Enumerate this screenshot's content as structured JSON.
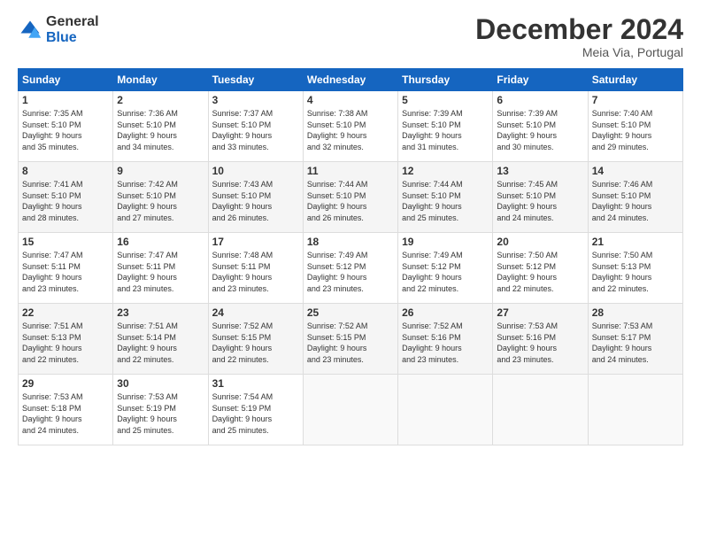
{
  "logo": {
    "general": "General",
    "blue": "Blue"
  },
  "header": {
    "month": "December 2024",
    "location": "Meia Via, Portugal"
  },
  "weekdays": [
    "Sunday",
    "Monday",
    "Tuesday",
    "Wednesday",
    "Thursday",
    "Friday",
    "Saturday"
  ],
  "weeks": [
    [
      {
        "day": "1",
        "info": "Sunrise: 7:35 AM\nSunset: 5:10 PM\nDaylight: 9 hours\nand 35 minutes."
      },
      {
        "day": "2",
        "info": "Sunrise: 7:36 AM\nSunset: 5:10 PM\nDaylight: 9 hours\nand 34 minutes."
      },
      {
        "day": "3",
        "info": "Sunrise: 7:37 AM\nSunset: 5:10 PM\nDaylight: 9 hours\nand 33 minutes."
      },
      {
        "day": "4",
        "info": "Sunrise: 7:38 AM\nSunset: 5:10 PM\nDaylight: 9 hours\nand 32 minutes."
      },
      {
        "day": "5",
        "info": "Sunrise: 7:39 AM\nSunset: 5:10 PM\nDaylight: 9 hours\nand 31 minutes."
      },
      {
        "day": "6",
        "info": "Sunrise: 7:39 AM\nSunset: 5:10 PM\nDaylight: 9 hours\nand 30 minutes."
      },
      {
        "day": "7",
        "info": "Sunrise: 7:40 AM\nSunset: 5:10 PM\nDaylight: 9 hours\nand 29 minutes."
      }
    ],
    [
      {
        "day": "8",
        "info": "Sunrise: 7:41 AM\nSunset: 5:10 PM\nDaylight: 9 hours\nand 28 minutes."
      },
      {
        "day": "9",
        "info": "Sunrise: 7:42 AM\nSunset: 5:10 PM\nDaylight: 9 hours\nand 27 minutes."
      },
      {
        "day": "10",
        "info": "Sunrise: 7:43 AM\nSunset: 5:10 PM\nDaylight: 9 hours\nand 26 minutes."
      },
      {
        "day": "11",
        "info": "Sunrise: 7:44 AM\nSunset: 5:10 PM\nDaylight: 9 hours\nand 26 minutes."
      },
      {
        "day": "12",
        "info": "Sunrise: 7:44 AM\nSunset: 5:10 PM\nDaylight: 9 hours\nand 25 minutes."
      },
      {
        "day": "13",
        "info": "Sunrise: 7:45 AM\nSunset: 5:10 PM\nDaylight: 9 hours\nand 24 minutes."
      },
      {
        "day": "14",
        "info": "Sunrise: 7:46 AM\nSunset: 5:10 PM\nDaylight: 9 hours\nand 24 minutes."
      }
    ],
    [
      {
        "day": "15",
        "info": "Sunrise: 7:47 AM\nSunset: 5:11 PM\nDaylight: 9 hours\nand 23 minutes."
      },
      {
        "day": "16",
        "info": "Sunrise: 7:47 AM\nSunset: 5:11 PM\nDaylight: 9 hours\nand 23 minutes."
      },
      {
        "day": "17",
        "info": "Sunrise: 7:48 AM\nSunset: 5:11 PM\nDaylight: 9 hours\nand 23 minutes."
      },
      {
        "day": "18",
        "info": "Sunrise: 7:49 AM\nSunset: 5:12 PM\nDaylight: 9 hours\nand 23 minutes."
      },
      {
        "day": "19",
        "info": "Sunrise: 7:49 AM\nSunset: 5:12 PM\nDaylight: 9 hours\nand 22 minutes."
      },
      {
        "day": "20",
        "info": "Sunrise: 7:50 AM\nSunset: 5:12 PM\nDaylight: 9 hours\nand 22 minutes."
      },
      {
        "day": "21",
        "info": "Sunrise: 7:50 AM\nSunset: 5:13 PM\nDaylight: 9 hours\nand 22 minutes."
      }
    ],
    [
      {
        "day": "22",
        "info": "Sunrise: 7:51 AM\nSunset: 5:13 PM\nDaylight: 9 hours\nand 22 minutes."
      },
      {
        "day": "23",
        "info": "Sunrise: 7:51 AM\nSunset: 5:14 PM\nDaylight: 9 hours\nand 22 minutes."
      },
      {
        "day": "24",
        "info": "Sunrise: 7:52 AM\nSunset: 5:15 PM\nDaylight: 9 hours\nand 22 minutes."
      },
      {
        "day": "25",
        "info": "Sunrise: 7:52 AM\nSunset: 5:15 PM\nDaylight: 9 hours\nand 23 minutes."
      },
      {
        "day": "26",
        "info": "Sunrise: 7:52 AM\nSunset: 5:16 PM\nDaylight: 9 hours\nand 23 minutes."
      },
      {
        "day": "27",
        "info": "Sunrise: 7:53 AM\nSunset: 5:16 PM\nDaylight: 9 hours\nand 23 minutes."
      },
      {
        "day": "28",
        "info": "Sunrise: 7:53 AM\nSunset: 5:17 PM\nDaylight: 9 hours\nand 24 minutes."
      }
    ],
    [
      {
        "day": "29",
        "info": "Sunrise: 7:53 AM\nSunset: 5:18 PM\nDaylight: 9 hours\nand 24 minutes."
      },
      {
        "day": "30",
        "info": "Sunrise: 7:53 AM\nSunset: 5:19 PM\nDaylight: 9 hours\nand 25 minutes."
      },
      {
        "day": "31",
        "info": "Sunrise: 7:54 AM\nSunset: 5:19 PM\nDaylight: 9 hours\nand 25 minutes."
      },
      {
        "day": "",
        "info": ""
      },
      {
        "day": "",
        "info": ""
      },
      {
        "day": "",
        "info": ""
      },
      {
        "day": "",
        "info": ""
      }
    ]
  ]
}
